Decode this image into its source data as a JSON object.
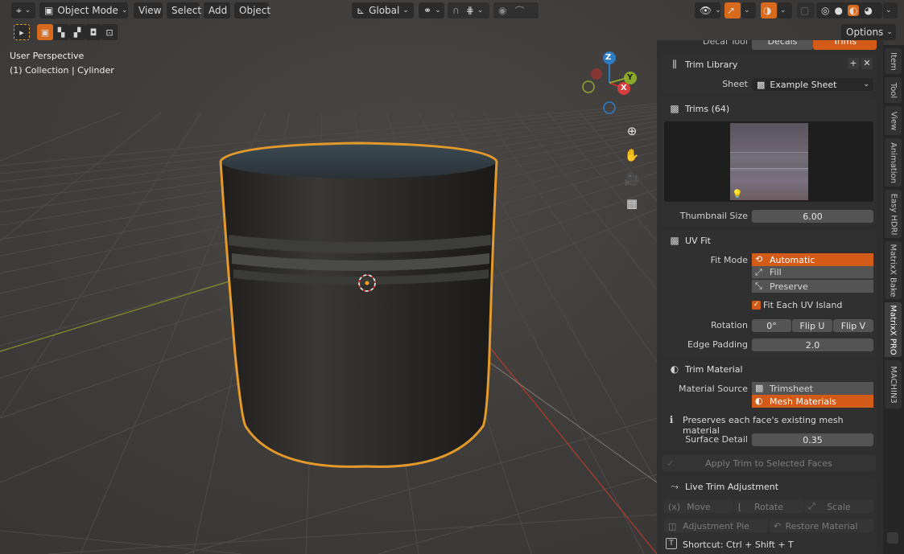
{
  "header": {
    "editor_icon": "axes-editor-icon",
    "mode": "Object Mode",
    "menus": [
      "View",
      "Select",
      "Add",
      "Object"
    ],
    "transform_orientation": "Global",
    "options": "Options"
  },
  "viewport": {
    "perspective": "User Perspective",
    "collection": "(1) Collection | Cylinder",
    "gizmo": {
      "z": "Z",
      "y": "Y",
      "x": "X"
    }
  },
  "sidebar": {
    "cut_tabs": {
      "decal": "Decal Tool",
      "decals": "Decals",
      "trims": "Trims"
    },
    "trim_library": {
      "title": "Trim Library",
      "sheet_label": "Sheet",
      "sheet_value": "Example Sheet"
    },
    "trims": {
      "title": "Trims (64)",
      "thumbnail_label": "Thumbnail Size",
      "thumbnail_value": "6.00"
    },
    "uv_fit": {
      "title": "UV Fit",
      "fit_mode_label": "Fit Mode",
      "fit_modes": [
        "Automatic",
        "Fill",
        "Preserve"
      ],
      "fit_each_label": "Fit Each UV Island",
      "rotation_label": "Rotation",
      "rotation_value": "0°",
      "flip_u": "Flip U",
      "flip_v": "Flip V",
      "edge_padding_label": "Edge Padding",
      "edge_padding_value": "2.0"
    },
    "trim_material": {
      "title": "Trim Material",
      "source_label": "Material Source",
      "sources": [
        "Trimsheet",
        "Mesh Materials"
      ],
      "info": "Preserves each face's existing mesh material",
      "surface_label": "Surface Detail",
      "surface_value": "0.35"
    },
    "apply_button": "Apply Trim to Selected Faces",
    "live_trim": {
      "title": "Live Trim Adjustment",
      "move": "Move",
      "rotate": "Rotate",
      "scale": "Scale",
      "pie": "Adjustment Pie",
      "restore": "Restore Material"
    },
    "shortcut": "Shortcut: Ctrl + Shift + T"
  },
  "tabs": [
    "Item",
    "Tool",
    "View",
    "Animation",
    "Easy HDRI",
    "MatrixX Bake",
    "MatrixX PRO",
    "MACHIN3"
  ],
  "colors": {
    "accent": "#d35a17",
    "selection": "#e8a33a"
  }
}
